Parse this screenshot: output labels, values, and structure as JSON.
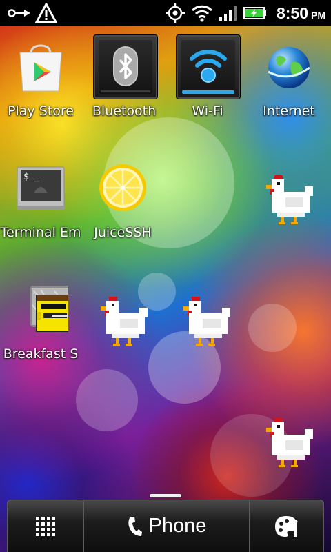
{
  "status_bar": {
    "time": "8:50",
    "ampm": "PM",
    "icons": [
      "usb-debug-icon",
      "warning-icon",
      "gps-icon",
      "wifi-icon",
      "signal-icon",
      "battery-charging-icon"
    ]
  },
  "apps": [
    {
      "label": "Play Store",
      "icon": "play-store-icon"
    },
    {
      "label": "Bluetooth",
      "icon": "bluetooth-icon"
    },
    {
      "label": "Wi-Fi",
      "icon": "wifi-toggle-icon"
    },
    {
      "label": "Internet",
      "icon": "globe-icon"
    },
    {
      "label": "Terminal Em",
      "icon": "terminal-icon"
    },
    {
      "label": "JuiceSSH",
      "icon": "lemon-icon"
    },
    {
      "label": "Breakfast S",
      "icon": "breakfast-icon"
    }
  ],
  "dock": {
    "phone_label": "Phone",
    "icons": [
      "app-drawer-icon",
      "phone-icon",
      "personalize-icon"
    ]
  },
  "colors": {
    "wifi_blue": "#2aa8f0",
    "battery_green": "#3cd23c"
  }
}
